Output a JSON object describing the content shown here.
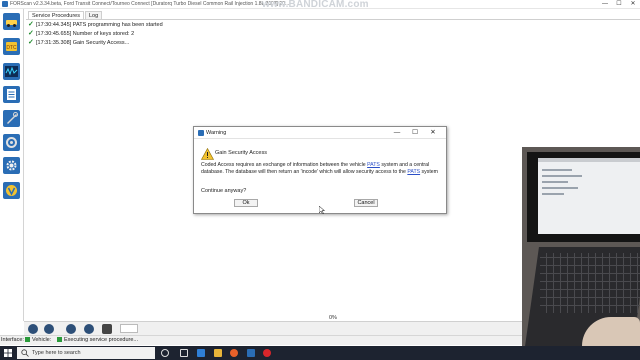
{
  "window": {
    "title": "FORScan v2.3.34.beta, Ford Transit Connect/Tourneo Connect [Duratorq Turbo Diesel Common Rail Injection 1.8L 2007] 20...",
    "watermark": "www.BANDICAM.com"
  },
  "tabs": [
    {
      "label": "Service Procedures"
    },
    {
      "label": "Log"
    }
  ],
  "log": [
    {
      "text": "[17:30:44.345] PATS programming has been started"
    },
    {
      "text": "[17:30:45.655] Number of keys stored: 2"
    },
    {
      "text": "[17:31:35.308] Gain Security Access..."
    }
  ],
  "dialog": {
    "title": "Warning",
    "heading": "Gain Security Access",
    "body_1": "Coded Access requires an exchange of information between the vehicle ",
    "link_1": "PATS",
    "body_2": " system and a central database. The database will then return an 'incode' which will allow security access to the ",
    "link_2": "PATS",
    "body_3": " system",
    "question": "Continue anyway?",
    "ok_label": "Ok",
    "cancel_label": "Cancel"
  },
  "progress": {
    "label": "0%",
    "value": 0
  },
  "status": {
    "interface_label": "Interface:",
    "vehicle_label": "Vehicle:",
    "task_label": "Executing service procedure..."
  },
  "taskbar": {
    "search_placeholder": "Type here to search"
  },
  "colors": {
    "accent": "#2b4fc7",
    "ok_green": "#1d8a2a",
    "toolbar_blue": "#2d4f78",
    "taskbar": "#1d2330"
  }
}
